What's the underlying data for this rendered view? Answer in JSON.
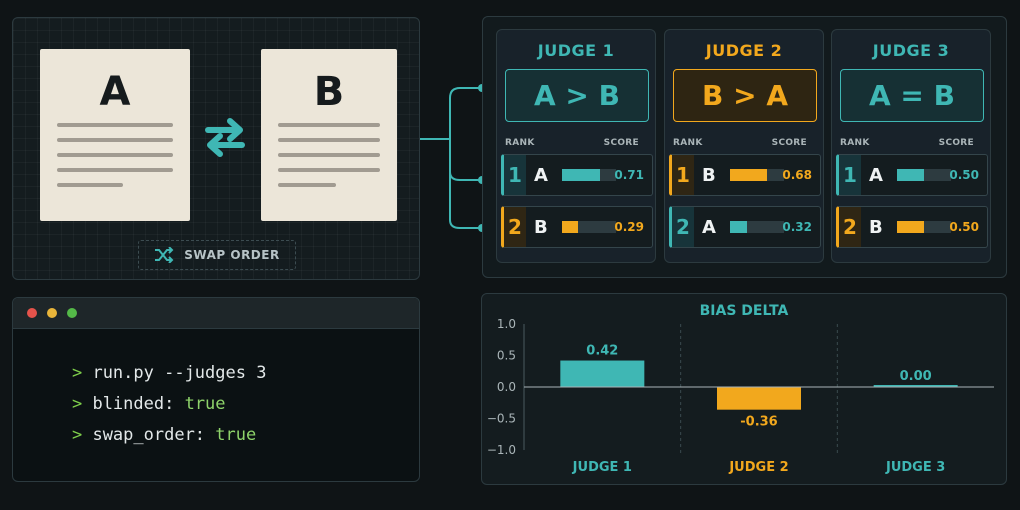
{
  "documents": {
    "left_label": "A",
    "right_label": "B",
    "swap_button_label": "SWAP ORDER"
  },
  "judges": [
    {
      "title": "JUDGE 1",
      "verdict": "A > B",
      "verdict_color": "#3fb7b4",
      "rank_header": "RANK",
      "score_header": "SCORE",
      "rows": [
        {
          "rank": "1",
          "label": "A",
          "score": "0.71",
          "value": 0.71,
          "color": "#3fb7b4"
        },
        {
          "rank": "2",
          "label": "B",
          "score": "0.29",
          "value": 0.29,
          "color": "#f2a81d"
        }
      ]
    },
    {
      "title": "JUDGE 2",
      "verdict": "B > A",
      "verdict_color": "#f2a81d",
      "rank_header": "RANK",
      "score_header": "SCORE",
      "rows": [
        {
          "rank": "1",
          "label": "B",
          "score": "0.68",
          "value": 0.68,
          "color": "#f2a81d"
        },
        {
          "rank": "2",
          "label": "A",
          "score": "0.32",
          "value": 0.32,
          "color": "#3fb7b4"
        }
      ]
    },
    {
      "title": "JUDGE 3",
      "verdict": "A = B",
      "verdict_color": "#3fb7b4",
      "rank_header": "RANK",
      "score_header": "SCORE",
      "rows": [
        {
          "rank": "1",
          "label": "A",
          "score": "0.50",
          "value": 0.5,
          "color": "#3fb7b4"
        },
        {
          "rank": "2",
          "label": "B",
          "score": "0.50",
          "value": 0.5,
          "color": "#f2a81d"
        }
      ]
    }
  ],
  "terminal": {
    "prompt": ">",
    "lines": [
      {
        "key": "run.py --judges 3",
        "value": ""
      },
      {
        "key": "blinded: ",
        "value": "true"
      },
      {
        "key": "swap_order: ",
        "value": "true"
      }
    ]
  },
  "colors": {
    "teal": "#3fb7b4",
    "amber": "#f2a81d",
    "background": "#0f1416"
  },
  "chart_data": {
    "type": "bar",
    "title": "BIAS DELTA",
    "categories": [
      "JUDGE 1",
      "JUDGE 2",
      "JUDGE 3"
    ],
    "values": [
      0.42,
      -0.36,
      0.0
    ],
    "value_labels": [
      "0.42",
      "-0.36",
      "0.00"
    ],
    "bar_colors": [
      "#3fb7b4",
      "#f2a81d",
      "#3fb7b4"
    ],
    "ylim": [
      -1.0,
      1.0
    ],
    "yticks": [
      1.0,
      0.5,
      0.0,
      -0.5,
      -1.0
    ],
    "ytick_labels": [
      "1.0",
      "0.5",
      "0.0",
      "−0.5",
      "−1.0"
    ],
    "xlabel": "",
    "ylabel": "",
    "grid": "vertical dashed separators"
  }
}
